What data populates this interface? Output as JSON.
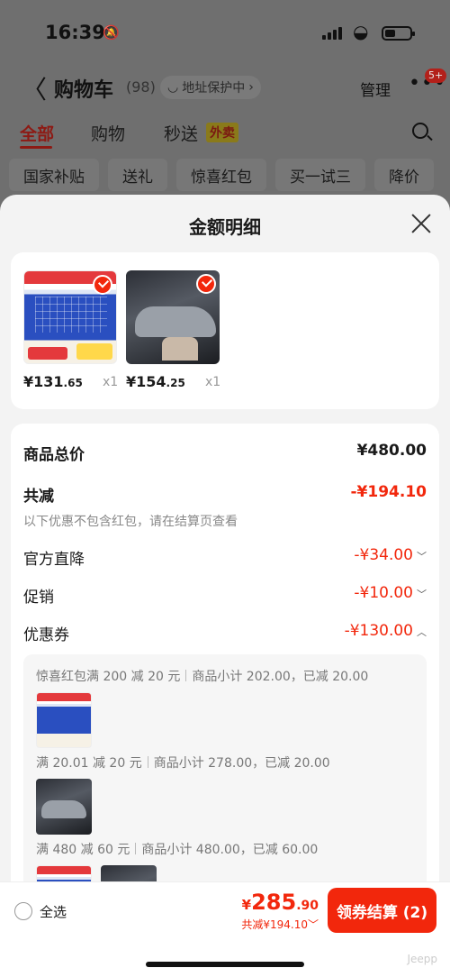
{
  "status_bar": {
    "time": "16:39"
  },
  "nav": {
    "back": "〈",
    "title": "购物车",
    "count": "(98)",
    "address": "地址保护中",
    "address_arrow": "›",
    "manage": "管理",
    "more": "•••",
    "badge": "5+"
  },
  "tabs": [
    {
      "label": "全部"
    },
    {
      "label": "购物"
    },
    {
      "label": "秒送"
    }
  ],
  "tab_tag": "外卖",
  "chips": [
    "国家补贴",
    "送礼",
    "惊喜红包",
    "买一试三",
    "降价"
  ],
  "sheet": {
    "title": "金额明细",
    "items": [
      {
        "price_int": "¥131",
        "price_dec": ".65",
        "qty": "x1"
      },
      {
        "price_int": "¥154",
        "price_dec": ".25",
        "qty": "x1"
      }
    ],
    "rows": {
      "total_label": "商品总价",
      "total_value": "¥480.00",
      "discount_label": "共减",
      "discount_value": "-¥194.10",
      "note": "以下优惠不包含红包，请在结算页查看",
      "official_label": "官方直降",
      "official_value": "-¥34.00",
      "promo_label": "促销",
      "promo_value": "-¥10.00",
      "coupon_label": "优惠券",
      "coupon_value": "-¥130.00"
    },
    "coupons": [
      {
        "name": "惊喜红包满 200 减 20 元",
        "detail": "商品小计 202.00，已减 20.00"
      },
      {
        "name": "满 20.01 减 20 元",
        "detail": "商品小计 278.00，已减 20.00"
      },
      {
        "name": "满 480 减 60 元",
        "detail": "商品小计 480.00，已减 60.00"
      }
    ]
  },
  "bottom": {
    "select_all": "全选",
    "currency": "¥",
    "total_int": "285",
    "total_dec": ".90",
    "saved": "共减¥194.10",
    "checkout": "领券结算 (2)",
    "watermark": "Jeepp"
  },
  "colors": {
    "accent": "#f2270c"
  }
}
